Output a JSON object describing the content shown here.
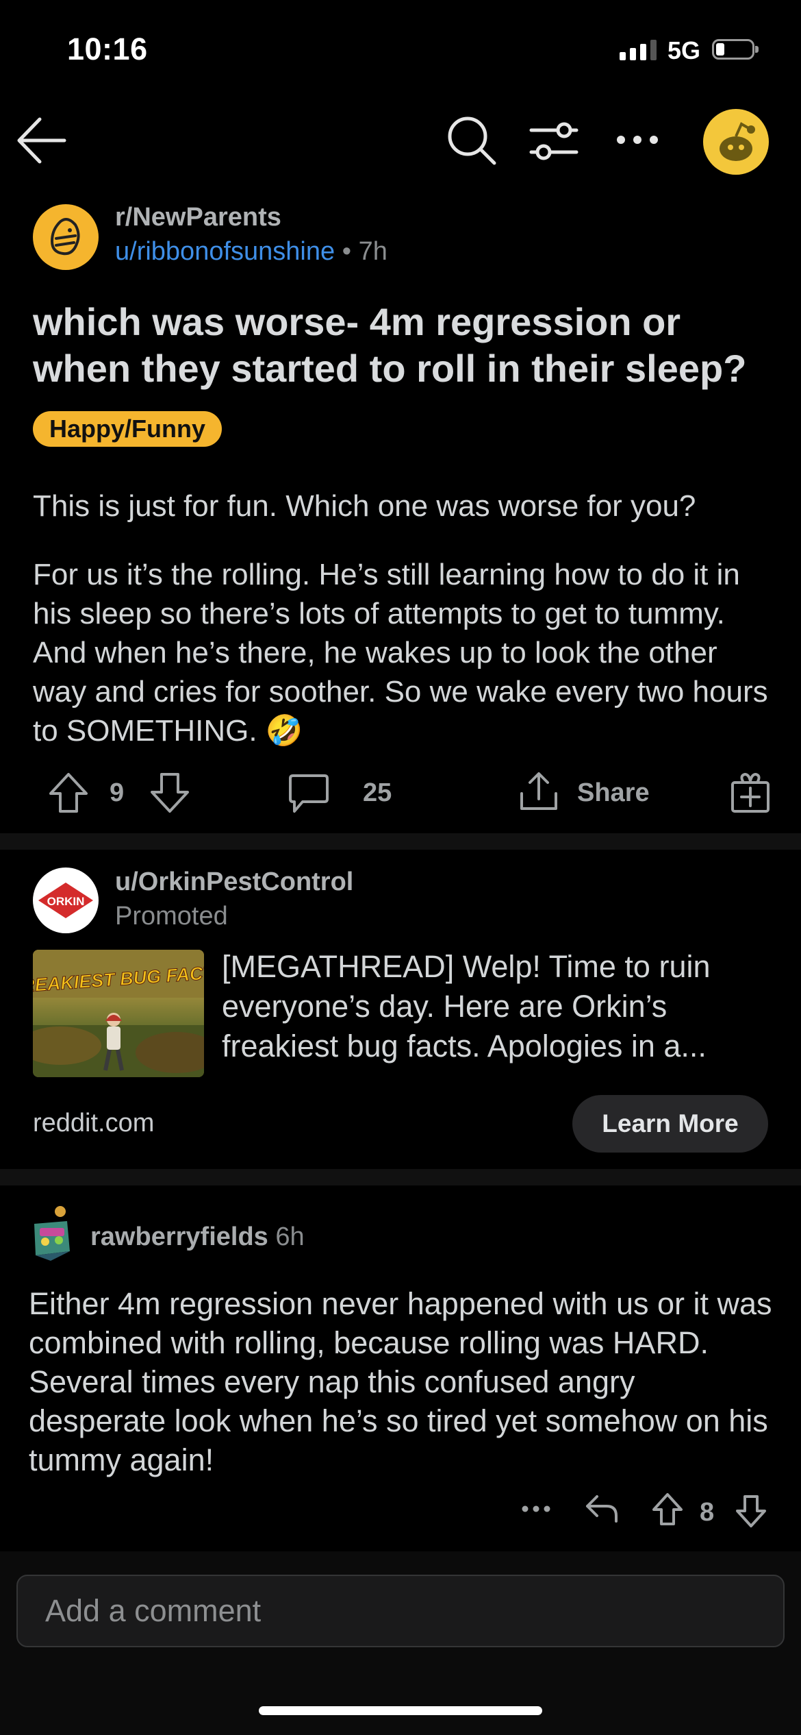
{
  "status_bar": {
    "time": "10:16",
    "network": "5G",
    "battery_level": 0.2
  },
  "post": {
    "subreddit": "r/NewParents",
    "author": "u/ribbonofsunshine",
    "age": "7h",
    "title": "which was worse- 4m regression or when they started to roll in their sleep?",
    "flair": "Happy/Funny",
    "body": [
      "This is just for fun. Which one was worse for you?",
      "For us it’s the rolling. He’s still learning how to do it in his sleep so there’s lots of attempts to get to tummy. And when he’s there, he wakes up to look the other way and cries for soother. So we wake every two hours to SOMETHING. 🤣"
    ],
    "votes": "9",
    "comments": "25",
    "share_label": "Share"
  },
  "ad": {
    "user": "u/OrkinPestControl",
    "promoted_label": "Promoted",
    "logo_text": "ORKIN",
    "thumb_text": "FREAKIEST BUG FACTS",
    "title": "[MEGATHREAD] Welp! Time to ruin everyone’s day. Here are Orkin’s freakiest bug facts. Apologies in a...",
    "domain": "reddit.com",
    "cta": "Learn More"
  },
  "comment": {
    "user": "rawberryfields",
    "age": "6h",
    "body": "Either 4m regression never happened with us or it was combined with rolling, because rolling was HARD. Several times every nap this confused angry desperate look when he’s so tired yet somehow on his tummy again!",
    "votes": "8"
  },
  "composer": {
    "placeholder": "Add a comment"
  },
  "colors": {
    "flair": "#f5b52e",
    "link": "#3f8fe8",
    "avatar": "#f3c73b"
  }
}
